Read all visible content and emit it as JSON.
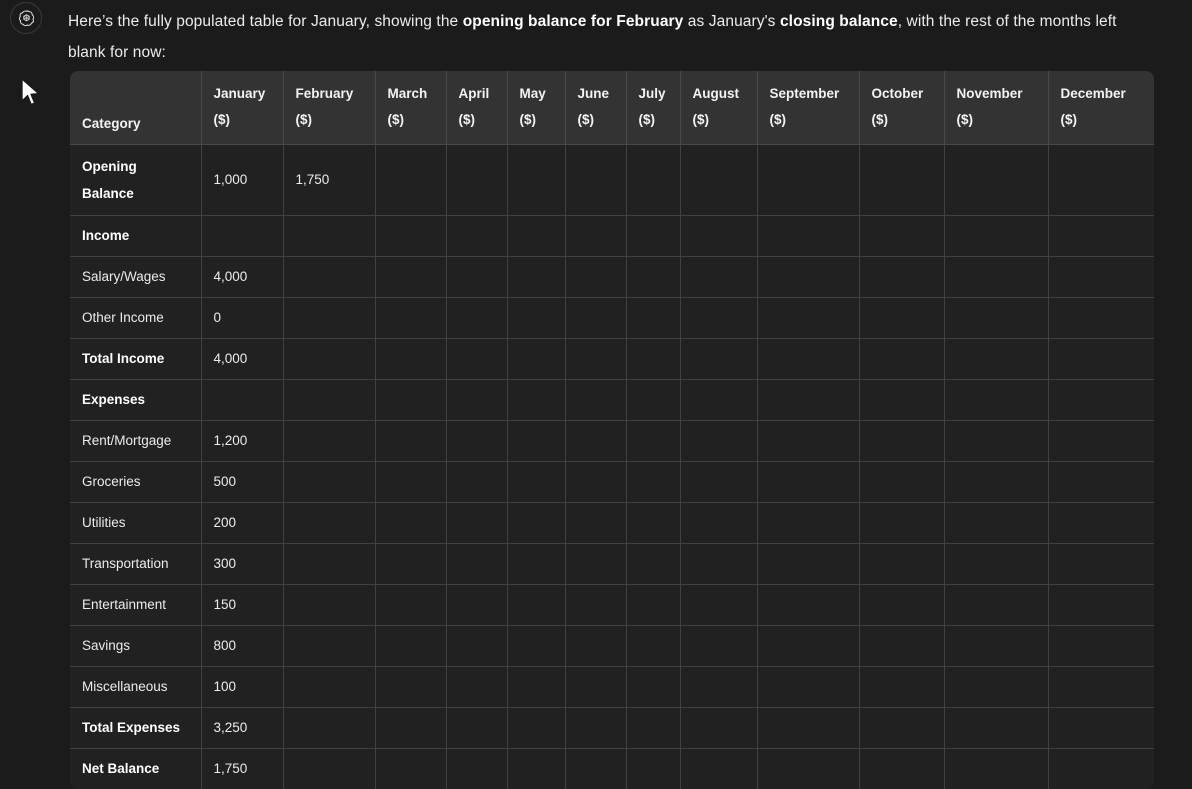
{
  "assistant": {
    "avatar_icon": "openai-logo-icon"
  },
  "cursor": {
    "icon": "mouse-pointer-icon"
  },
  "message": {
    "intro_part1": "Here’s the fully populated table for January, showing the ",
    "intro_bold1": "opening balance for February",
    "intro_part2": " as January's ",
    "intro_bold2": "closing balance",
    "intro_part3": ", with the rest of the months left blank for now:"
  },
  "colors": {
    "page_background": "#1b1b1b",
    "header_background": "#333333",
    "cell_background": "#212121",
    "border": "#414141",
    "header_border": "#4a4a4a",
    "text": "#ececec"
  },
  "table": {
    "headers": [
      {
        "label": "Category",
        "unit": ""
      },
      {
        "label": "January",
        "unit": "($)"
      },
      {
        "label": "February",
        "unit": "($)"
      },
      {
        "label": "March",
        "unit": "($)"
      },
      {
        "label": "April",
        "unit": "($)"
      },
      {
        "label": "May",
        "unit": "($)"
      },
      {
        "label": "June",
        "unit": "($)"
      },
      {
        "label": "July",
        "unit": "($)"
      },
      {
        "label": "August",
        "unit": "($)"
      },
      {
        "label": "September",
        "unit": "($)"
      },
      {
        "label": "October",
        "unit": "($)"
      },
      {
        "label": "November",
        "unit": "($)"
      },
      {
        "label": "December",
        "unit": "($)"
      }
    ],
    "rows": [
      {
        "label": "Opening Balance",
        "bold": true,
        "tall": true,
        "values": [
          "1,000",
          "1,750",
          "",
          "",
          "",
          "",
          "",
          "",
          "",
          "",
          "",
          ""
        ]
      },
      {
        "label": "Income",
        "bold": true,
        "tall": false,
        "values": [
          "",
          "",
          "",
          "",
          "",
          "",
          "",
          "",
          "",
          "",
          "",
          ""
        ]
      },
      {
        "label": "Salary/Wages",
        "bold": false,
        "tall": false,
        "values": [
          "4,000",
          "",
          "",
          "",
          "",
          "",
          "",
          "",
          "",
          "",
          "",
          ""
        ]
      },
      {
        "label": "Other Income",
        "bold": false,
        "tall": false,
        "values": [
          "0",
          "",
          "",
          "",
          "",
          "",
          "",
          "",
          "",
          "",
          "",
          ""
        ]
      },
      {
        "label": "Total Income",
        "bold": true,
        "tall": false,
        "values": [
          "4,000",
          "",
          "",
          "",
          "",
          "",
          "",
          "",
          "",
          "",
          "",
          ""
        ]
      },
      {
        "label": "Expenses",
        "bold": true,
        "tall": false,
        "values": [
          "",
          "",
          "",
          "",
          "",
          "",
          "",
          "",
          "",
          "",
          "",
          ""
        ]
      },
      {
        "label": "Rent/Mortgage",
        "bold": false,
        "tall": false,
        "values": [
          "1,200",
          "",
          "",
          "",
          "",
          "",
          "",
          "",
          "",
          "",
          "",
          ""
        ]
      },
      {
        "label": "Groceries",
        "bold": false,
        "tall": false,
        "values": [
          "500",
          "",
          "",
          "",
          "",
          "",
          "",
          "",
          "",
          "",
          "",
          ""
        ]
      },
      {
        "label": "Utilities",
        "bold": false,
        "tall": false,
        "values": [
          "200",
          "",
          "",
          "",
          "",
          "",
          "",
          "",
          "",
          "",
          "",
          ""
        ]
      },
      {
        "label": "Transportation",
        "bold": false,
        "tall": false,
        "values": [
          "300",
          "",
          "",
          "",
          "",
          "",
          "",
          "",
          "",
          "",
          "",
          ""
        ]
      },
      {
        "label": "Entertainment",
        "bold": false,
        "tall": false,
        "values": [
          "150",
          "",
          "",
          "",
          "",
          "",
          "",
          "",
          "",
          "",
          "",
          ""
        ]
      },
      {
        "label": "Savings",
        "bold": false,
        "tall": false,
        "values": [
          "800",
          "",
          "",
          "",
          "",
          "",
          "",
          "",
          "",
          "",
          "",
          ""
        ]
      },
      {
        "label": "Miscellaneous",
        "bold": false,
        "tall": false,
        "values": [
          "100",
          "",
          "",
          "",
          "",
          "",
          "",
          "",
          "",
          "",
          "",
          ""
        ]
      },
      {
        "label": "Total Expenses",
        "bold": true,
        "tall": false,
        "values": [
          "3,250",
          "",
          "",
          "",
          "",
          "",
          "",
          "",
          "",
          "",
          "",
          ""
        ]
      },
      {
        "label": "Net Balance",
        "bold": true,
        "tall": false,
        "values": [
          "1,750",
          "",
          "",
          "",
          "",
          "",
          "",
          "",
          "",
          "",
          "",
          ""
        ]
      }
    ]
  }
}
